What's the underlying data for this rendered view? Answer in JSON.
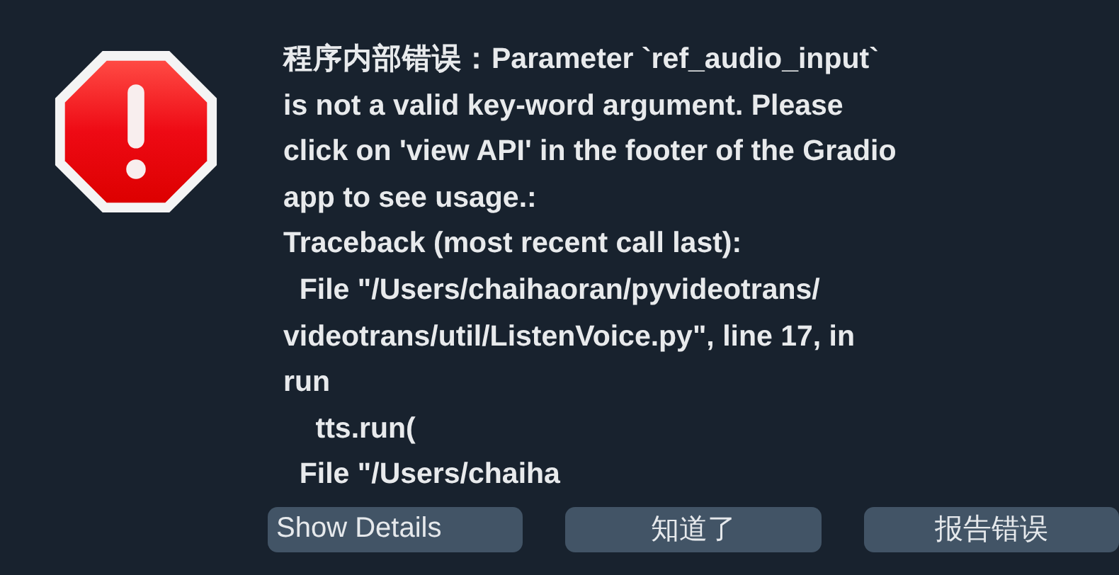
{
  "dialog": {
    "message": "程序内部错误：Parameter `ref_audio_input`\nis not a valid key-word argument. Please\nclick on 'view API' in the footer of the Gradio\napp to see usage.:\nTraceback (most recent call last):\n  File \"/Users/chaihaoran/pyvideotrans/\nvideotrans/util/ListenVoice.py\", line 17, in\nrun\n    tts.run(\n  File \"/Users/chaiha",
    "buttons": [
      {
        "label": "Show Details"
      },
      {
        "label": "知道了"
      },
      {
        "label": "报告错误"
      }
    ]
  }
}
